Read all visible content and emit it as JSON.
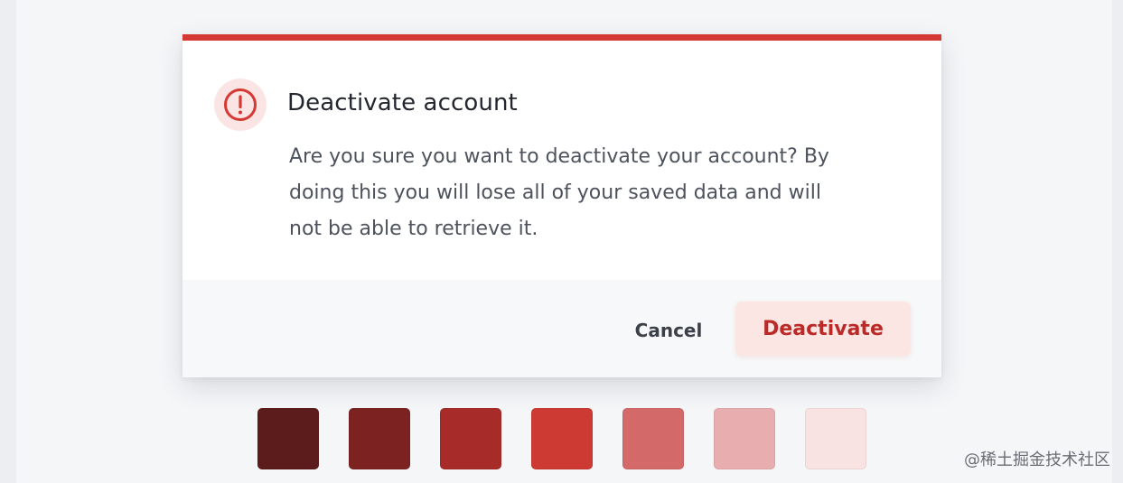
{
  "dialog": {
    "title": "Deactivate account",
    "message_lines": [
      "Are you sure you want to deactivate your account? By",
      "doing this you will lose all of your saved data and will",
      "not be able to retrieve it."
    ],
    "icon": "exclamation-circle-icon",
    "cancel_label": "Cancel",
    "confirm_label": "Deactivate"
  },
  "palette": {
    "swatches": [
      "#5c1c1b",
      "#7c2322",
      "#a72b28",
      "#cc3a33",
      "#d4696a",
      "#e8aeaf",
      "#f9e2e2"
    ]
  },
  "colors": {
    "accent": "#d43a33",
    "confirm_text": "#bb2a26",
    "confirm_bg": "#fbe6e4",
    "page_bg": "#f5f6f8"
  },
  "watermark": "@稀土掘金技术社区"
}
